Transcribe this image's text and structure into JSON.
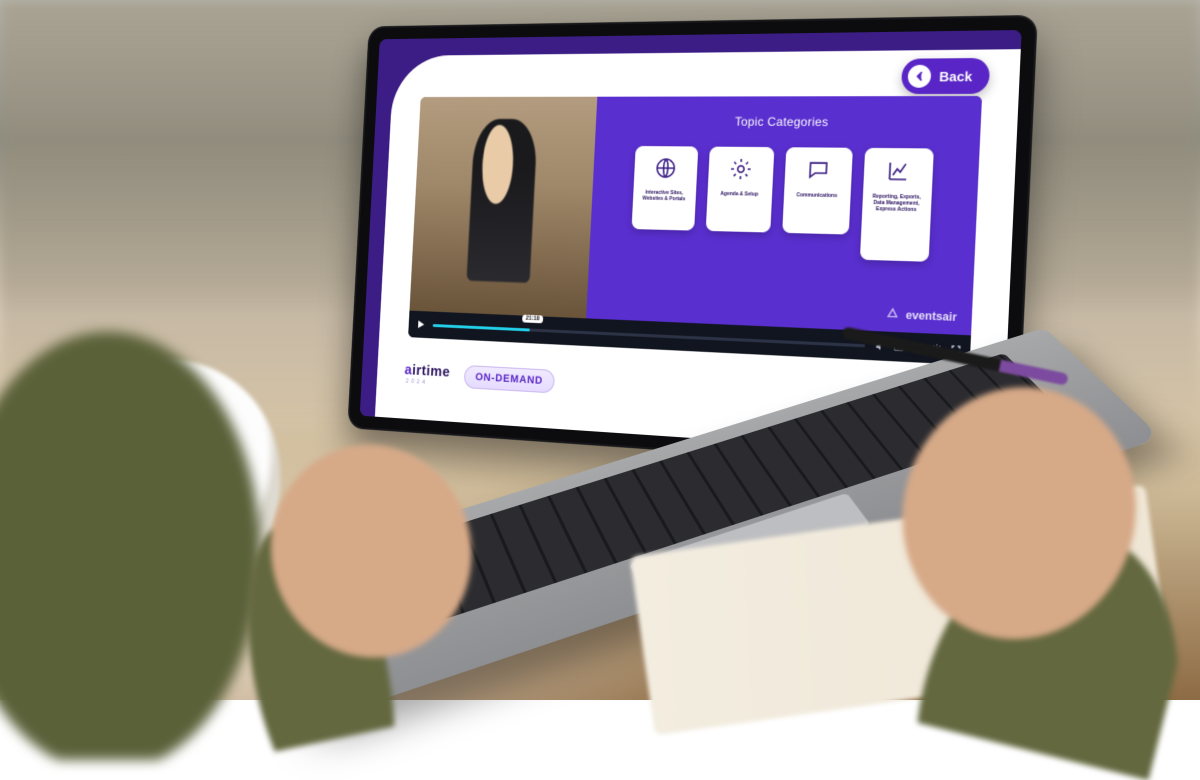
{
  "colors": {
    "brand_purple": "#5925c6",
    "deep_purple": "#3b1d85",
    "accent_cyan": "#23d0e9"
  },
  "back": {
    "label": "Back"
  },
  "video": {
    "timecode": "21:18",
    "progress_pct": 24,
    "slide": {
      "title": "Topic Categories",
      "cards": [
        {
          "icon": "globe",
          "label": "Interactive Sites, Websites & Portals"
        },
        {
          "icon": "gear",
          "label": "Agenda & Setup"
        },
        {
          "icon": "chat",
          "label": "Communications"
        },
        {
          "icon": "chart",
          "label": "Reporting, Exports, Data Management, Express Actions"
        }
      ],
      "brand": "eventsair"
    }
  },
  "footer": {
    "logo_primary": "airtime",
    "logo_year": "2024",
    "badge": "ON-DEMAND"
  }
}
